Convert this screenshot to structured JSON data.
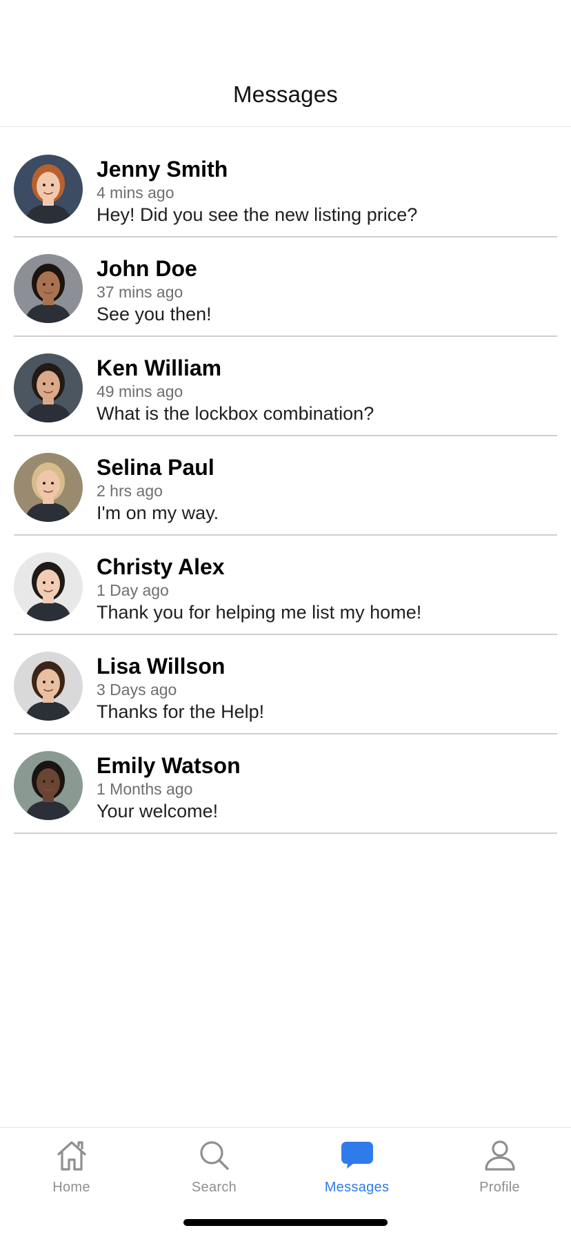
{
  "header": {
    "title": "Messages"
  },
  "conversations": [
    {
      "name": "Jenny Smith",
      "time": "4 mins ago",
      "message": "Hey! Did you see the new listing price?",
      "bg": "#3b4c63",
      "skin": "#f0c9ad",
      "hair": "#b8602e"
    },
    {
      "name": "John Doe",
      "time": "37 mins ago",
      "message": "See you then!",
      "bg": "#8c8f95",
      "skin": "#a97352",
      "hair": "#1d1410"
    },
    {
      "name": "Ken William",
      "time": "49 mins ago",
      "message": "What is the lockbox combination?",
      "bg": "#4c5660",
      "skin": "#d9a98a",
      "hair": "#231a15"
    },
    {
      "name": "Selina Paul",
      "time": "2 hrs ago",
      "message": "I'm on my way.",
      "bg": "#9a8a6f",
      "skin": "#eec7aa",
      "hair": "#d8bd8c"
    },
    {
      "name": "Christy Alex",
      "time": "1 Day ago",
      "message": "Thank you for helping me list my home!",
      "bg": "#e8e8e8",
      "skin": "#f1cdb5",
      "hair": "#1f1a18"
    },
    {
      "name": "Lisa Willson",
      "time": "3 Days ago",
      "message": "Thanks for the Help!",
      "bg": "#d9d9d9",
      "skin": "#e9bfa2",
      "hair": "#3b2418"
    },
    {
      "name": "Emily Watson",
      "time": "1 Months ago",
      "message": "Your welcome!",
      "bg": "#8a9a93",
      "skin": "#6b4533",
      "hair": "#1a1411"
    }
  ],
  "tabbar": {
    "tabs": [
      {
        "label": "Home",
        "icon": "home-icon"
      },
      {
        "label": "Search",
        "icon": "search-icon"
      },
      {
        "label": "Messages",
        "icon": "message-bubble-icon"
      },
      {
        "label": "Profile",
        "icon": "profile-icon"
      }
    ],
    "active": "Messages"
  },
  "colors": {
    "accent": "#2f7bea",
    "inactive": "#8e8e93",
    "divider": "#cfcfcf"
  }
}
